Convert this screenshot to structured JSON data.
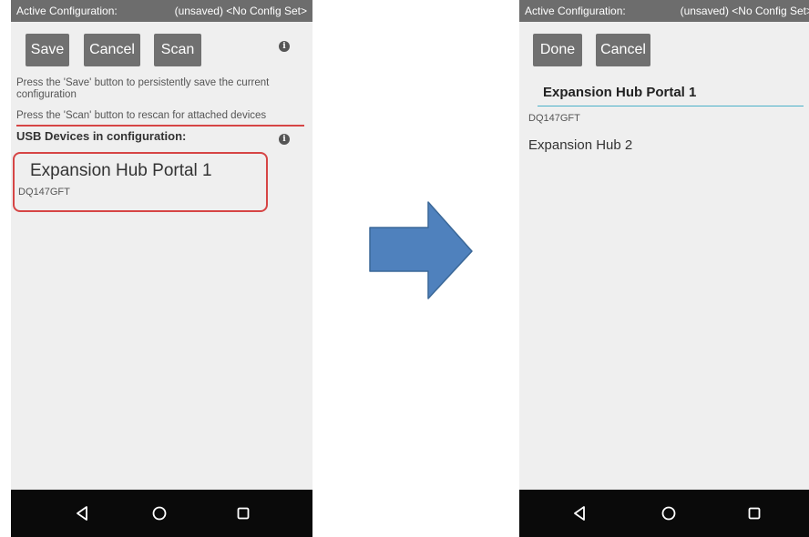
{
  "left_screen": {
    "active_config_label": "Active Configuration:",
    "active_config_value": "(unsaved) <No Config Set>",
    "buttons": {
      "save": "Save",
      "cancel": "Cancel",
      "scan": "Scan"
    },
    "info_icon": "i",
    "instructions": [
      "Press the 'Save' button to persistently save the current configuration",
      "Press the 'Scan' button to rescan for attached devices"
    ],
    "section_title": "USB Devices in configuration:",
    "device": {
      "name": "Expansion Hub Portal 1",
      "serial": "DQ147GFT"
    }
  },
  "right_screen": {
    "active_config_label": "Active Configuration:",
    "active_config_value": "(unsaved) <No Config Set>",
    "buttons": {
      "done": "Done",
      "cancel": "Cancel"
    },
    "portal_name": "Expansion Hub Portal 1",
    "portal_serial": "DQ147GFT",
    "hub_name": "Expansion Hub 2"
  },
  "nav_icons": [
    "back-icon",
    "home-icon",
    "recents-icon"
  ],
  "colors": {
    "arrow": "#4f81bd",
    "highlight": "#d64545",
    "topbar": "#6d6d6d",
    "button": "#707070"
  }
}
